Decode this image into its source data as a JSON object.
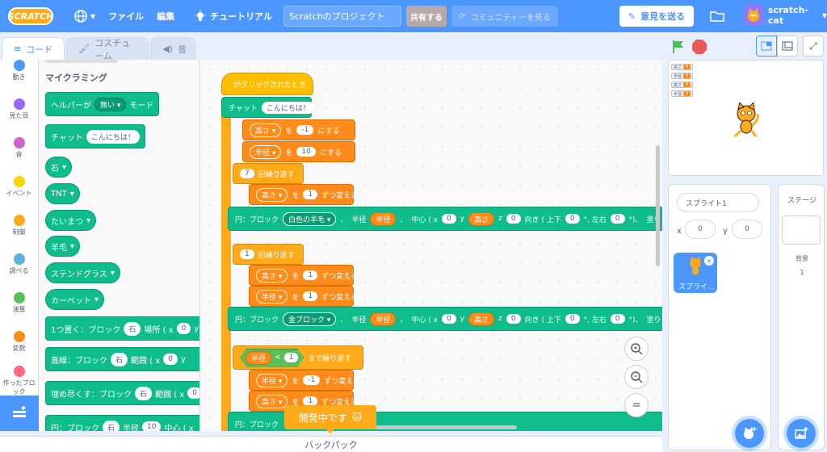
{
  "menubar": {
    "logo": "SCRATCH",
    "file": "ファイル",
    "edit": "編集",
    "tutorial": "チュートリアル",
    "project_title": "Scratchのプロジェクト",
    "share": "共有する",
    "community": "コミュニティーを見る",
    "feedback": "意見を送る",
    "username": "scratch-cat"
  },
  "tabs": {
    "code": "コード",
    "costumes": "コスチューム",
    "sounds": "音"
  },
  "categories": [
    {
      "label": "動き",
      "color": "#4c97ff"
    },
    {
      "label": "見た目",
      "color": "#9966ff"
    },
    {
      "label": "音",
      "color": "#cf63cf"
    },
    {
      "label": "イベント",
      "color": "#ffd500"
    },
    {
      "label": "制御",
      "color": "#ffab19"
    },
    {
      "label": "調べる",
      "color": "#5cb1d6"
    },
    {
      "label": "演算",
      "color": "#59c059"
    },
    {
      "label": "変数",
      "color": "#ff8c1a"
    },
    {
      "label": "作ったブロック",
      "color": "#ff6680"
    },
    {
      "label": "マイクラミング",
      "color": "#0fbd8c"
    }
  ],
  "palette": {
    "title": "マイクラミング",
    "helper_label": "ヘルパーが",
    "helper_value": "無い",
    "helper_suffix": "モード",
    "chat_label": "チャット",
    "chat_value": "こんにちは！",
    "stone": "石",
    "tnt": "TNT",
    "torch": "たいまつ",
    "wool": "羊毛",
    "stained_glass": "ステンドグラス",
    "carpet": "カーペット",
    "place_one": "1つ置く：ブロック",
    "place_one_block": "石",
    "place_one_pos": "場所 ( x",
    "place_one_x": "0",
    "place_one_y": "y",
    "line": "直線：ブロック",
    "line_block": "石",
    "line_range": "範囲 ( x",
    "line_x": "0",
    "line_y": "y",
    "fill": "埋め尽くす：ブロック",
    "fill_block": "石",
    "fill_range": "範囲 ( x",
    "fill_x": "0",
    "circle": "円：ブロック",
    "circle_block": "石",
    "circle_radius": "半径",
    "circle_radius_value": "10",
    "circle_center": "中心 ( x"
  },
  "script": {
    "hat": "がクリックされたとき",
    "chat": "チャット",
    "chat_value": "こんにちは！",
    "set_height_var": "高さ",
    "set_to": "を",
    "set_height_value": "-1",
    "set_suffix": "にする",
    "set_radius_var": "半径",
    "set_radius_value": "10",
    "repeat1_count": "7",
    "repeat_label": "回繰り返す",
    "change_label": "ずつ変える",
    "change_height_value": "1",
    "circle_label": "円：ブロック",
    "circle1_block": "白色の羊毛",
    "circle_comma": "、",
    "radius_label": "半径",
    "radius_var": "半径",
    "center_label": "中心 ( x",
    "x_value": "0",
    "y_label": "y",
    "y_var": "高さ",
    "z_label": "z",
    "z_value": "0",
    "orient_label": "向き ( 上下",
    "orient_value": "0",
    "lr_label": "°, 左右",
    "lr_value": "0",
    "tail_label": "°)、",
    "tail2_label": "塗り",
    "repeat2_count": "1",
    "change_radius_value": "1",
    "circle2_block": "金ブロック",
    "until_var": "半径",
    "until_op": "<",
    "until_value": "1",
    "until_label": "まで繰り返す",
    "change_neg_value": "-1",
    "change_pos_value": "1",
    "circle3_label": "円：ブロック"
  },
  "dev_toast": "開発中です",
  "backpack": "バックパック",
  "stage_vars": [
    "高さ",
    "半径",
    "高さ",
    "半径"
  ],
  "sprite": {
    "name_value": "スプライト1",
    "x_label": "x",
    "x_value": "0",
    "y_label": "y",
    "y_value": "0",
    "thumb_label": "スプライ..."
  },
  "stage_pane": {
    "title": "ステージ",
    "backdrops_label": "背景",
    "backdrops_count": "1"
  },
  "colors": {
    "accent": "#4c97ff",
    "myblocks": "#0fbd8c",
    "variables": "#ff8c1a",
    "events": "#ffbf00"
  }
}
